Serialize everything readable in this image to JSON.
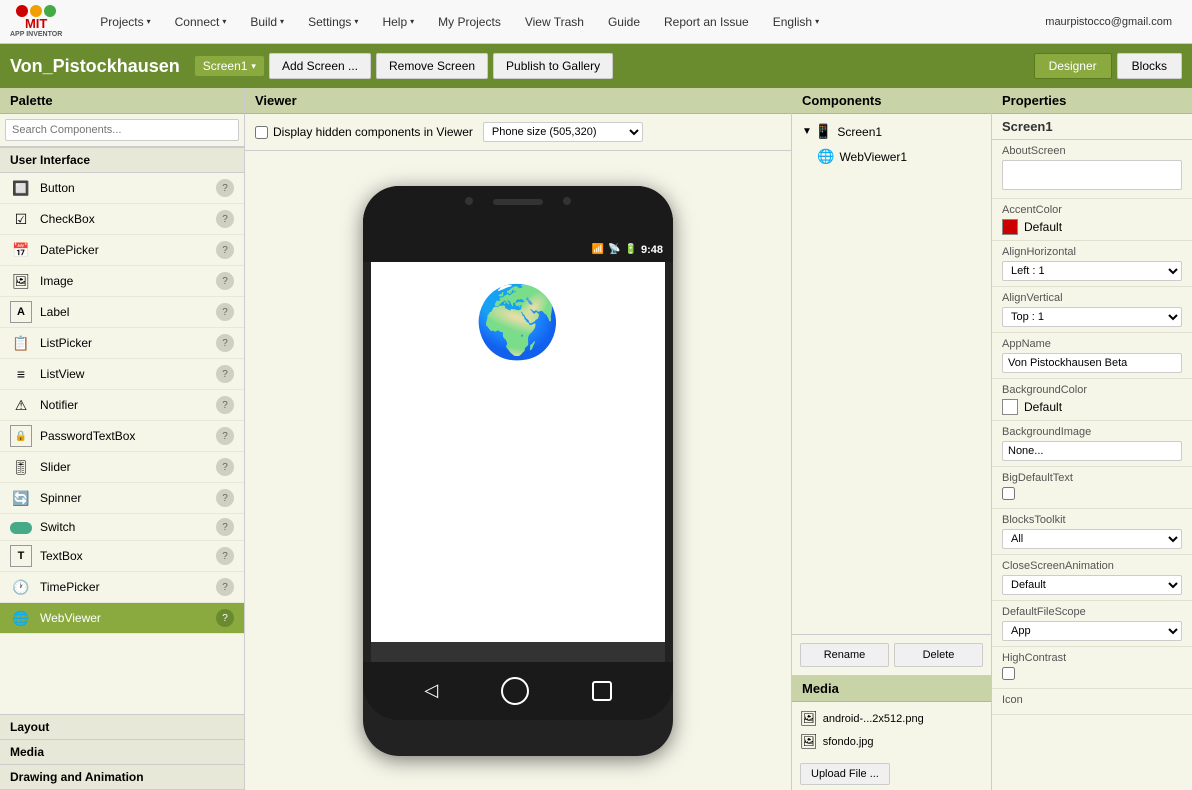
{
  "navbar": {
    "logo_mit": "MIT",
    "logo_sub": "APP INVENTOR",
    "items": [
      {
        "label": "Projects",
        "has_arrow": true
      },
      {
        "label": "Connect",
        "has_arrow": true
      },
      {
        "label": "Build",
        "has_arrow": true
      },
      {
        "label": "Settings",
        "has_arrow": true
      },
      {
        "label": "Help",
        "has_arrow": true
      },
      {
        "label": "My Projects",
        "has_arrow": false
      },
      {
        "label": "View Trash",
        "has_arrow": false
      },
      {
        "label": "Guide",
        "has_arrow": false
      },
      {
        "label": "Report an Issue",
        "has_arrow": false
      },
      {
        "label": "English",
        "has_arrow": true
      },
      {
        "label": "maurpistocco@gmail.com",
        "has_arrow": false
      }
    ]
  },
  "toolbar": {
    "project_title": "Von_Pistockhausen",
    "screen_selector": "Screen1",
    "add_screen_label": "Add Screen ...",
    "remove_screen_label": "Remove Screen",
    "publish_label": "Publish to Gallery",
    "designer_label": "Designer",
    "blocks_label": "Blocks"
  },
  "palette": {
    "title": "Palette",
    "search_placeholder": "Search Components...",
    "sections": [
      {
        "name": "User Interface",
        "items": [
          {
            "name": "Button",
            "icon": "🔲"
          },
          {
            "name": "CheckBox",
            "icon": "☑"
          },
          {
            "name": "DatePicker",
            "icon": "📅"
          },
          {
            "name": "Image",
            "icon": "🖼"
          },
          {
            "name": "Label",
            "icon": "A"
          },
          {
            "name": "ListPicker",
            "icon": "📋"
          },
          {
            "name": "ListView",
            "icon": "≡"
          },
          {
            "name": "Notifier",
            "icon": "⚠"
          },
          {
            "name": "PasswordTextBox",
            "icon": "🔒"
          },
          {
            "name": "Slider",
            "icon": "🎚"
          },
          {
            "name": "Spinner",
            "icon": "🔄"
          },
          {
            "name": "Switch",
            "icon": "⬛",
            "selected": true
          },
          {
            "name": "TextBox",
            "icon": "T"
          },
          {
            "name": "TimePicker",
            "icon": "🕐"
          },
          {
            "name": "WebViewer",
            "icon": "🌐",
            "highlighted": true
          }
        ]
      },
      {
        "name": "Layout"
      },
      {
        "name": "Media"
      },
      {
        "name": "Drawing and Animation"
      }
    ]
  },
  "viewer": {
    "title": "Viewer",
    "hidden_components_label": "Display hidden components in Viewer",
    "phone_size_label": "Phone size (505,320)",
    "status_time": "9:48",
    "globe_emoji": "🌍"
  },
  "components": {
    "title": "Components",
    "tree": [
      {
        "name": "Screen1",
        "icon": "📱",
        "expanded": true,
        "level": 0
      },
      {
        "name": "WebViewer1",
        "icon": "🌐",
        "level": 1
      }
    ],
    "rename_label": "Rename",
    "delete_label": "Delete"
  },
  "media": {
    "title": "Media",
    "items": [
      {
        "name": "android-...2x512.png",
        "icon": "🖼"
      },
      {
        "name": "sfondo.jpg",
        "icon": "🖼"
      }
    ],
    "upload_label": "Upload File ..."
  },
  "properties": {
    "title": "Properties",
    "screen_name": "Screen1",
    "props": [
      {
        "label": "AboutScreen",
        "type": "textarea",
        "value": ""
      },
      {
        "label": "AccentColor",
        "type": "color",
        "color": "#cc0000",
        "value": "Default"
      },
      {
        "label": "AlignHorizontal",
        "type": "select",
        "value": "Left : 1"
      },
      {
        "label": "AlignVertical",
        "type": "select",
        "value": "Top : 1"
      },
      {
        "label": "AppName",
        "type": "input",
        "value": "Von Pistockhausen Beta"
      },
      {
        "label": "BackgroundColor",
        "type": "color",
        "color": "#ffffff",
        "value": "Default"
      },
      {
        "label": "BackgroundImage",
        "type": "input",
        "value": "None..."
      },
      {
        "label": "BigDefaultText",
        "type": "checkbox",
        "value": false
      },
      {
        "label": "BlocksToolkit",
        "type": "select",
        "value": "All"
      },
      {
        "label": "CloseScreenAnimation",
        "type": "select",
        "value": "Default"
      },
      {
        "label": "DefaultFileScope",
        "type": "select",
        "value": "App"
      },
      {
        "label": "HighContrast",
        "type": "checkbox",
        "value": false
      },
      {
        "label": "Icon",
        "type": "label",
        "value": ""
      }
    ]
  }
}
